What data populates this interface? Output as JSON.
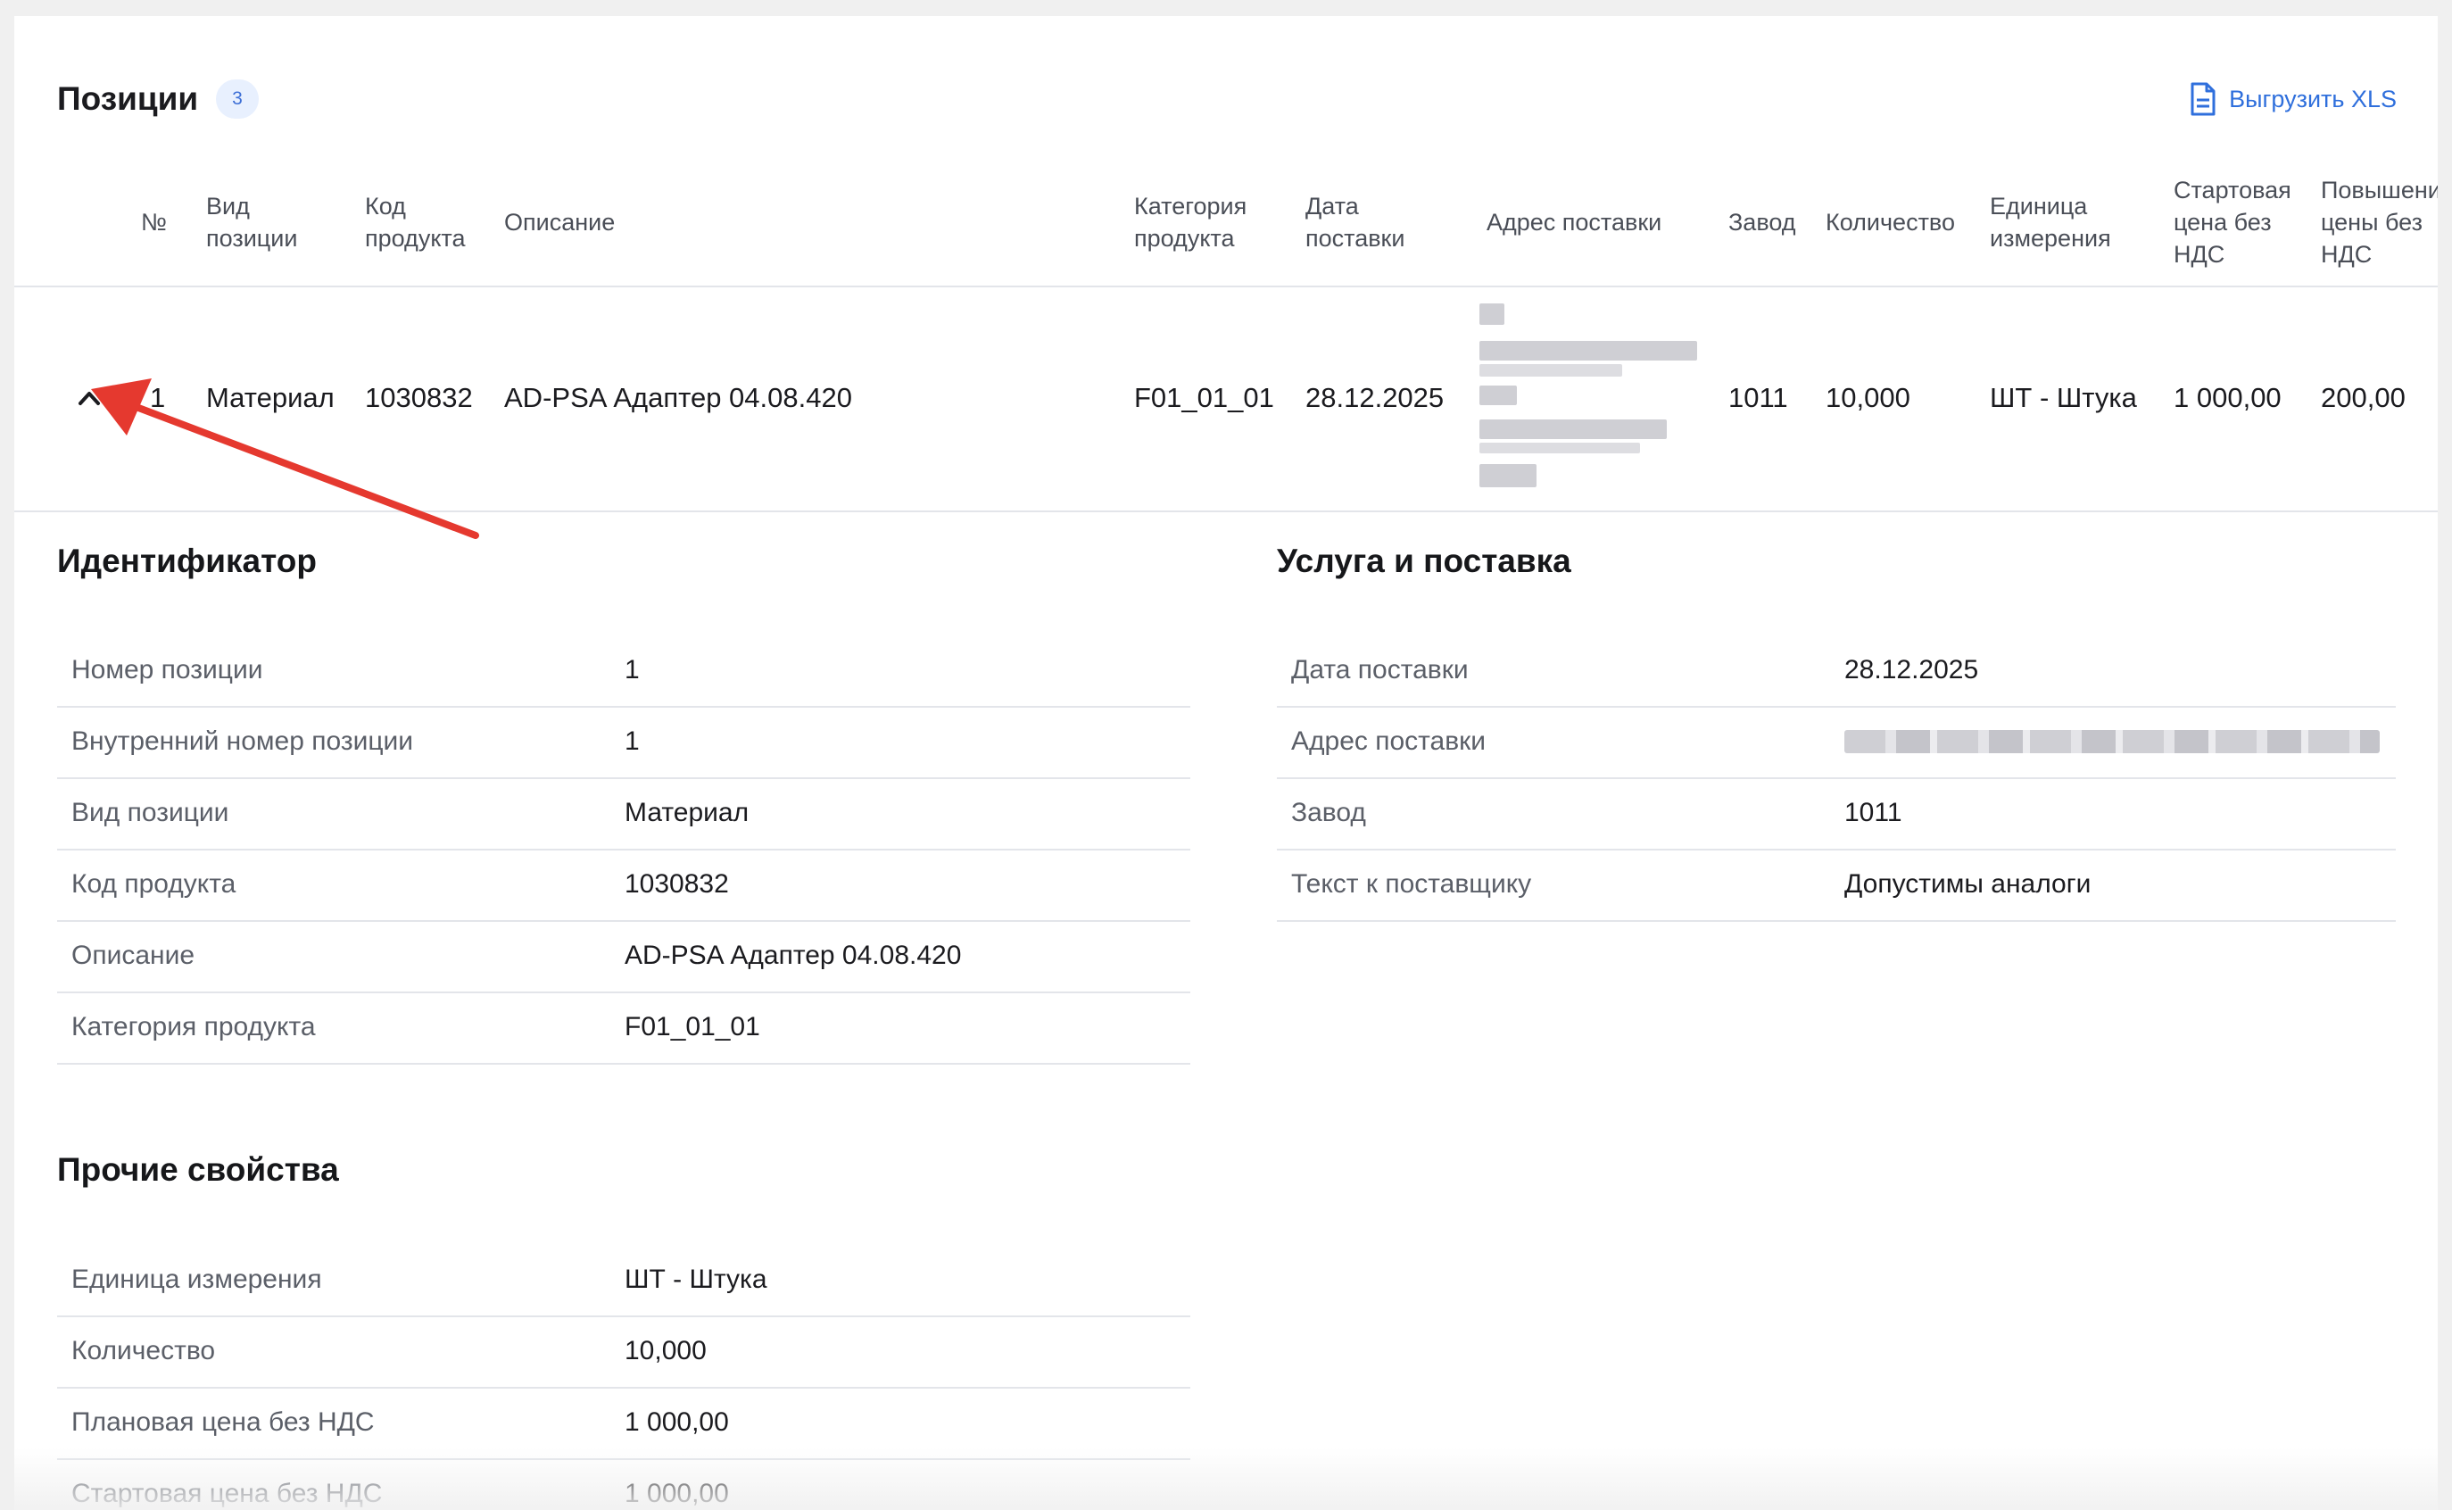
{
  "header": {
    "title": "Позиции",
    "count": "3",
    "export_label": "Выгрузить XLS",
    "export_icon": "document-icon"
  },
  "table": {
    "columns": [
      "№",
      "Вид\nпозиции",
      "Код\nпродукта",
      "Описание",
      "Категория\nпродукта",
      "Дата\nпоставки",
      "Адрес поставки",
      "Завод",
      "Количество",
      "Единица\nизмерения",
      "Стартовая\nцена без\nНДС",
      "Повышение\nцены без\nНДС"
    ],
    "row": {
      "expand_icon": "chevron-up-icon",
      "num": "1",
      "type": "Материал",
      "code": "1030832",
      "description": "AD-PSA Адаптер 04.08.420",
      "category": "F01_01_01",
      "date": "28.12.2025",
      "plant": "1011",
      "quantity": "10,000",
      "unit": "ШТ - Штука",
      "start_price": "1 000,00",
      "increase": "200,00"
    }
  },
  "identifier": {
    "title": "Идентификатор",
    "rows": [
      {
        "label": "Номер позиции",
        "value": "1"
      },
      {
        "label": "Внутренний номер позиции",
        "value": "1"
      },
      {
        "label": "Вид позиции",
        "value": "Материал"
      },
      {
        "label": "Код продукта",
        "value": "1030832"
      },
      {
        "label": "Описание",
        "value": "AD-PSA Адаптер 04.08.420"
      },
      {
        "label": "Категория продукта",
        "value": "F01_01_01"
      }
    ]
  },
  "service": {
    "title": "Услуга и поставка",
    "rows": [
      {
        "label": "Дата поставки",
        "value": "28.12.2025"
      },
      {
        "label": "Адрес поставки",
        "value": ""
      },
      {
        "label": "Завод",
        "value": "1011"
      },
      {
        "label": "Текст к поставщику",
        "value": "Допустимы аналоги"
      }
    ]
  },
  "other": {
    "title": "Прочие свойства",
    "rows": [
      {
        "label": "Единица измерения",
        "value": "ШТ - Штука"
      },
      {
        "label": "Количество",
        "value": "10,000"
      },
      {
        "label": "Плановая цена без НДС",
        "value": "1 000,00"
      },
      {
        "label": "Стартовая цена без НДС",
        "value": "1 000,00"
      }
    ]
  },
  "colors": {
    "accent": "#2f6fdc",
    "annotation_arrow": "#e5392f"
  }
}
